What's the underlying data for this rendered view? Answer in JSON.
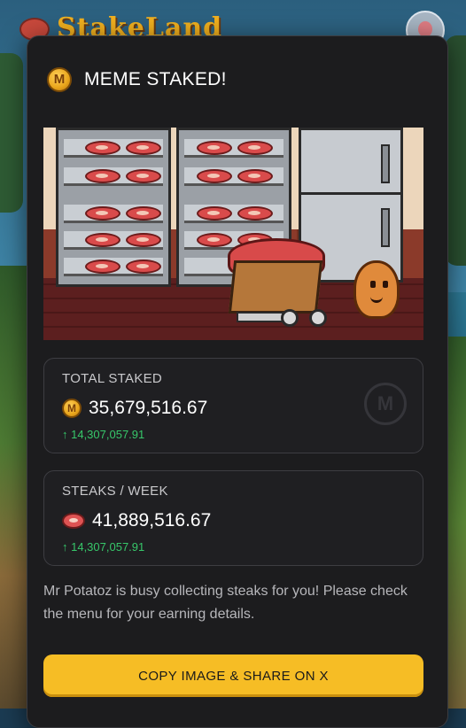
{
  "app": {
    "brand_name": "StakeLand"
  },
  "modal": {
    "title": "MEME STAKED!",
    "coin_letter": "M",
    "total_staked": {
      "label": "TOTAL STAKED",
      "value": "35,679,516.67",
      "delta": "↑ 14,307,057.91"
    },
    "steaks_per_week": {
      "label": "STEAKS / WEEK",
      "value": "41,889,516.67",
      "delta": "↑ 14,307,057.91"
    },
    "description": "Mr Potatoz is busy collecting steaks for you! Please check the menu for your earning details.",
    "share_button": "COPY IMAGE & SHARE ON X"
  },
  "colors": {
    "accent": "#f6bd25",
    "positive": "#37c76a",
    "panel": "#1c1c1e"
  }
}
